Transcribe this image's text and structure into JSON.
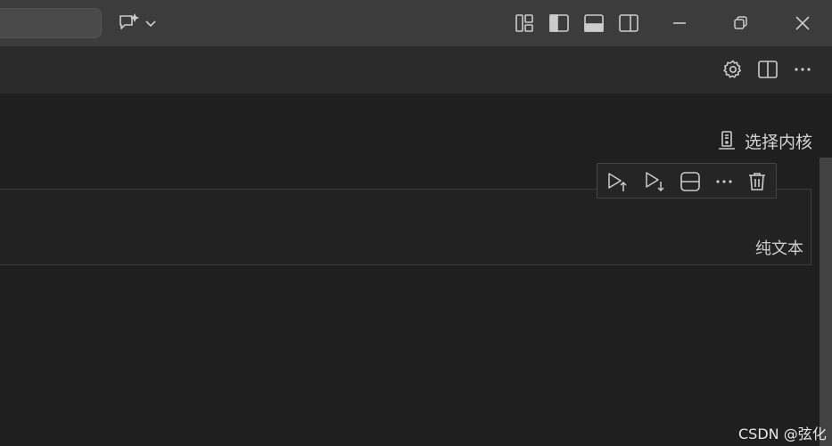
{
  "titlebar": {
    "icons": [
      "chat-sparkle-icon",
      "chevron-down-icon",
      "customize-layout-icon",
      "toggle-primary-sidebar-icon",
      "toggle-panel-icon",
      "toggle-secondary-sidebar-icon"
    ],
    "window_controls": [
      "minimize-icon",
      "restore-icon",
      "close-icon"
    ]
  },
  "editor_toolbar": {
    "icons": [
      "gear-icon",
      "split-editor-icon",
      "more-actions-icon"
    ]
  },
  "kernel_picker": {
    "label": "选择内核",
    "icon": "server-environment-icon"
  },
  "cell_toolbar": {
    "icons": [
      "execute-above-icon",
      "execute-below-icon",
      "split-cell-icon",
      "more-actions-icon",
      "delete-icon"
    ]
  },
  "cell": {
    "language": "纯文本"
  },
  "watermark": {
    "text": "CSDN @弦化"
  },
  "colors": {
    "titlebar_bg": "#3c3c3c",
    "toolbar_bg": "#2b2b2b",
    "editor_bg": "#1f1f1f",
    "icon_color": "#cccccc"
  }
}
